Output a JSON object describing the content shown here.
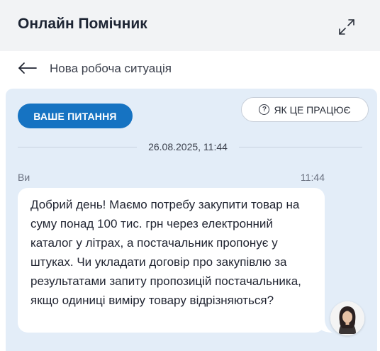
{
  "header": {
    "title": "Онлайн Помічник",
    "expand_icon": "expand-arrows-icon"
  },
  "subbar": {
    "back_icon": "arrow-left-icon",
    "title": "Нова робоча ситуація"
  },
  "chat": {
    "question_button_label": "ВАШЕ ПИТАННЯ",
    "how_it_works_label": "ЯК ЦЕ ПРАЦЮЄ",
    "how_it_works_icon": "question-circle-icon",
    "date_divider": "26.08.2025, 11:44",
    "message": {
      "sender": "Ви",
      "time": "11:44",
      "text": "Добрий день! Маємо потребу закупити товар на суму понад 100 тис. грн через електронний каталог у літрах, а постачальник пропонує у штуках. Чи укладати договір про закупівлю за результатами запиту пропозицій постачальника, якщо одиниці виміру товару відрізняються?"
    },
    "avatar_icon": "user-avatar-icon"
  },
  "colors": {
    "accent": "#1673c2",
    "chat_background": "#e3edf8",
    "header_background": "#f2f3f5"
  }
}
